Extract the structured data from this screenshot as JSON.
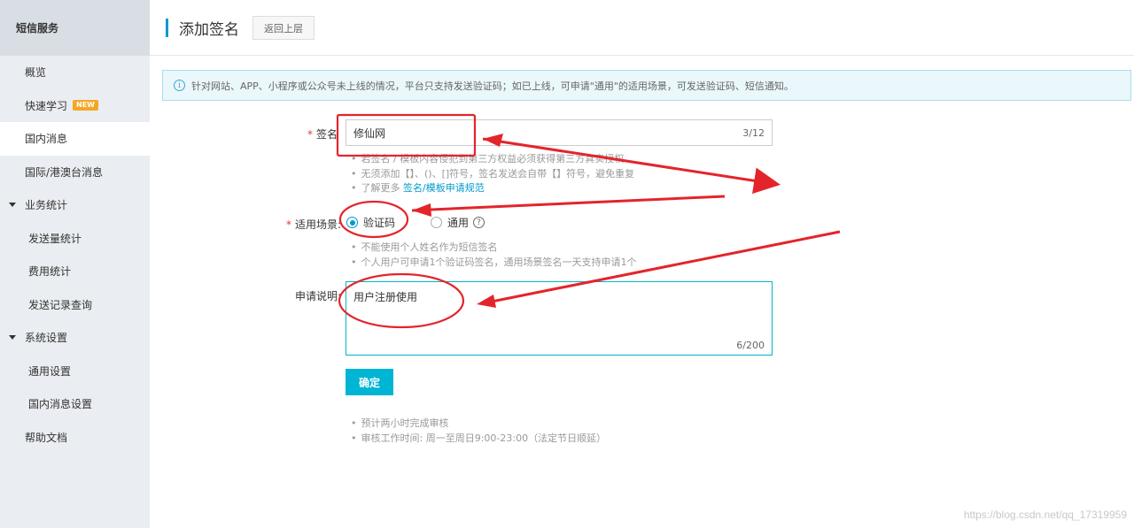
{
  "sidebar": {
    "header": "短信服务",
    "items": [
      {
        "label": "概览",
        "kind": "item"
      },
      {
        "label": "快速学习",
        "kind": "item",
        "badge": "NEW"
      },
      {
        "label": "国内消息",
        "kind": "item",
        "active": true
      },
      {
        "label": "国际/港澳台消息",
        "kind": "item"
      },
      {
        "label": "业务统计",
        "kind": "group"
      },
      {
        "label": "发送量统计",
        "kind": "sub"
      },
      {
        "label": "费用统计",
        "kind": "sub"
      },
      {
        "label": "发送记录查询",
        "kind": "sub"
      },
      {
        "label": "系统设置",
        "kind": "group"
      },
      {
        "label": "通用设置",
        "kind": "sub"
      },
      {
        "label": "国内消息设置",
        "kind": "sub"
      },
      {
        "label": "帮助文档",
        "kind": "item"
      }
    ]
  },
  "header": {
    "title": "添加签名",
    "back_label": "返回上层"
  },
  "notice": {
    "text": "针对网站、APP、小程序或公众号未上线的情况，平台只支持发送验证码；如已上线，可申请\"通用\"的适用场景，可发送验证码、短信通知。"
  },
  "form": {
    "required_mark": "*",
    "signature": {
      "label": "签名",
      "value": "修仙网",
      "count": "3/12",
      "hints": [
        "若签名 / 模板内容侵犯到第三方权益必须获得第三方真实授权",
        "无须添加【】、()、[]符号，签名发送会自带【】符号，避免重复"
      ],
      "more_prefix": "了解更多 ",
      "more_link": "签名/模板申请规范"
    },
    "scene": {
      "label": "适用场景",
      "options": [
        {
          "label": "验证码",
          "selected": true
        },
        {
          "label": "通用",
          "selected": false
        }
      ],
      "help_icon": "?",
      "hints": [
        "不能使用个人姓名作为短信签名",
        "个人用户可申请1个验证码签名，通用场景签名一天支持申请1个"
      ]
    },
    "description": {
      "label": "申请说明",
      "value": "用户注册使用",
      "count": "6/200"
    },
    "submit_label": "确定",
    "footer_hints": [
      "预计两小时完成审核",
      "审核工作时间: 周一至周日9:00-23:00（法定节日顺延）"
    ]
  },
  "info_icon": "i",
  "watermark": "https://blog.csdn.net/qq_17319959",
  "colors": {
    "accent": "#0099cc",
    "button": "#00b5d4",
    "annotation": "#e4242b"
  }
}
